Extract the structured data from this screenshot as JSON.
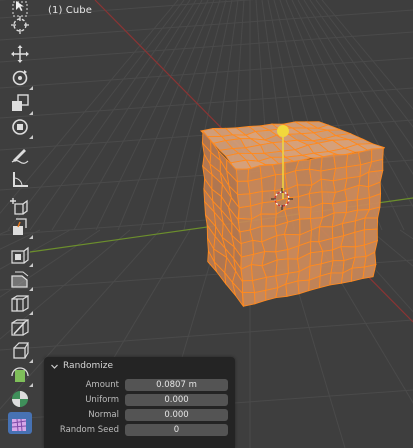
{
  "viewport": {
    "object_label": "(1) Cube",
    "background_color": "#3e3e3e",
    "x_axis_color": "#9b3a3a",
    "y_axis_color": "#6c8f2c",
    "mesh_face_color": "#c8885a",
    "mesh_edge_color": "#ff8a1f",
    "gizmo_color": "#f2d83c"
  },
  "toolbar": {
    "tools": [
      {
        "name": "select-box-icon"
      },
      {
        "name": "cursor-icon"
      },
      {
        "name": "move-icon"
      },
      {
        "name": "rotate-icon"
      },
      {
        "name": "scale-icon"
      },
      {
        "name": "transform-icon"
      },
      {
        "name": "annotate-icon"
      },
      {
        "name": "measure-icon"
      },
      {
        "name": "add-cube-icon"
      },
      {
        "name": "extrude-region-icon"
      },
      {
        "name": "inset-faces-icon"
      },
      {
        "name": "bevel-icon"
      },
      {
        "name": "loop-cut-icon"
      },
      {
        "name": "knife-icon"
      },
      {
        "name": "poly-build-icon"
      },
      {
        "name": "spin-icon"
      },
      {
        "name": "smooth-randomize-icon"
      },
      {
        "name": "edge-slide-icon"
      }
    ]
  },
  "redo_panel": {
    "title": "Randomize",
    "fields": [
      {
        "label": "Amount",
        "value": "0.0807 m"
      },
      {
        "label": "Uniform",
        "value": "0.000"
      },
      {
        "label": "Normal",
        "value": "0.000"
      },
      {
        "label": "Random Seed",
        "value": "0"
      }
    ]
  }
}
